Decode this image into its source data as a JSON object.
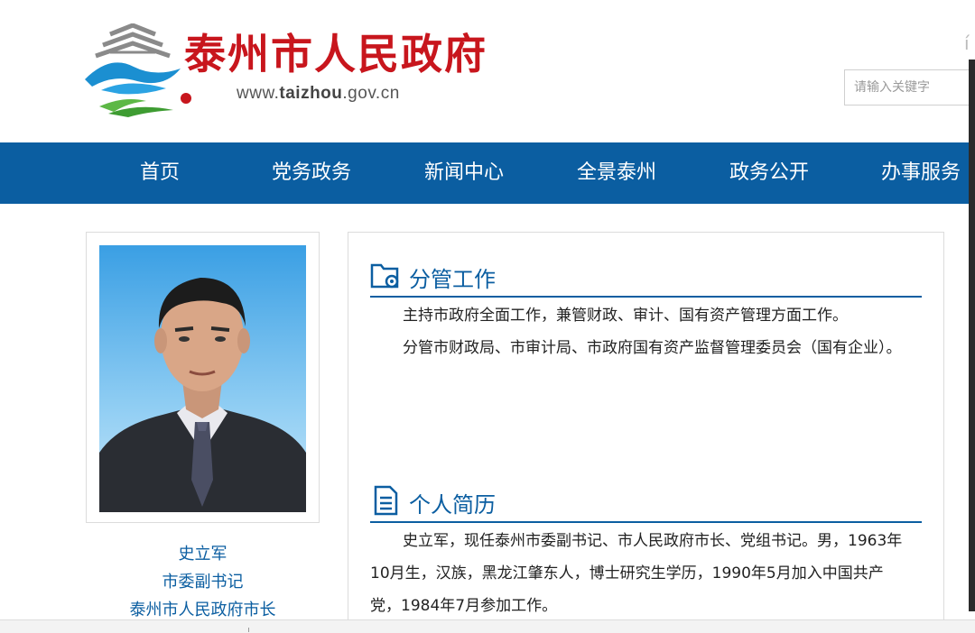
{
  "header": {
    "site_title": "泰州市人民政府",
    "url_prefix": "www.",
    "url_domain": "taizhou",
    "url_suffix": ".gov.cn",
    "search_placeholder": "请输入关键字",
    "corner_glyph": "í"
  },
  "nav": {
    "items": [
      "首页",
      "党务政务",
      "新闻中心",
      "全景泰州",
      "政务公开",
      "办事服务"
    ]
  },
  "profile": {
    "name": "史立军",
    "position1": "市委副书记",
    "position2": "泰州市人民政府市长"
  },
  "sections": {
    "responsibilities": {
      "title": "分管工作",
      "paragraphs": [
        "主持市政府全面工作，兼管财政、审计、国有资产管理方面工作。",
        "分管市财政局、市审计局、市政府国有资产监督管理委员会（国有企业）。"
      ]
    },
    "resume": {
      "title": "个人简历",
      "paragraphs": [
        "史立军，现任泰州市委副书记、市人民政府市长、党组书记。男，1963年10月生，汉族，黑龙江肇东人，博士研究生学历，1990年5月加入中国共产党，1984年7月参加工作。"
      ]
    }
  },
  "colors": {
    "brand_red": "#c8161d",
    "nav_blue": "#0b5ea1",
    "text_dark": "#222222"
  }
}
